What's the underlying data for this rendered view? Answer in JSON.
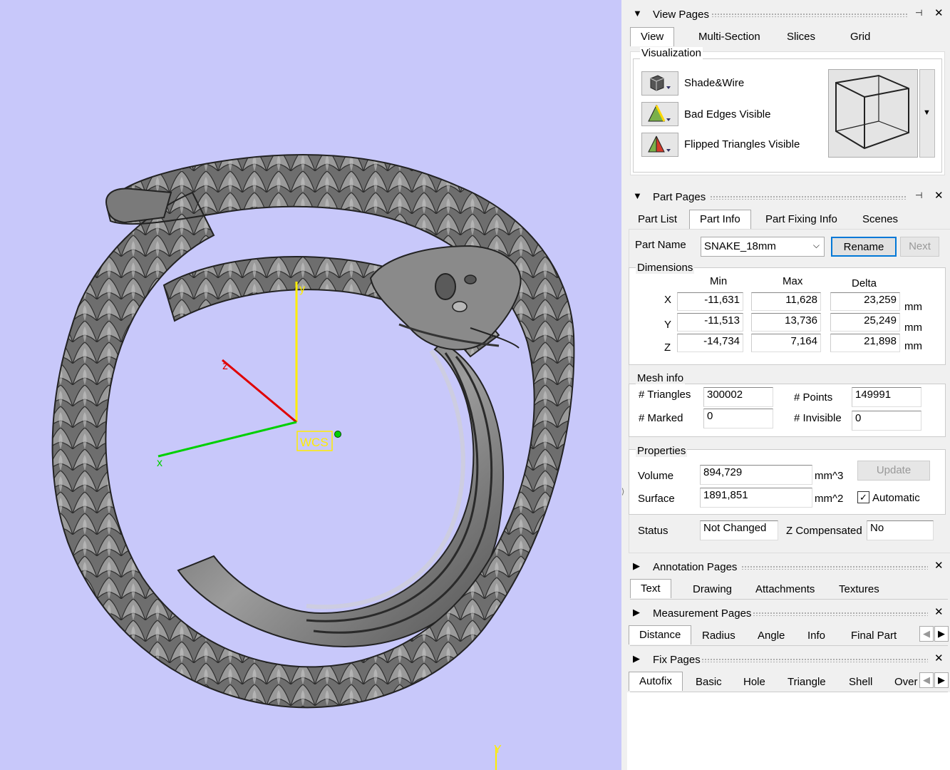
{
  "viewport": {
    "background": "#c8c8fa",
    "axis_labels": {
      "y": "y",
      "z": "z",
      "x": "x",
      "wcs": "WCS",
      "bottom_y": "Y"
    },
    "axis_colors": {
      "x": "#00d000",
      "y": "#ffee00",
      "z": "#e00000"
    },
    "model_color": "#6f6f6f"
  },
  "view_pages": {
    "title": "View Pages",
    "tabs": [
      "View",
      "Multi-Section",
      "Slices",
      "Grid"
    ],
    "active_tab": "View",
    "visualization": {
      "label": "Visualization",
      "items": [
        {
          "icon": "shade-wire-icon",
          "label": "Shade&Wire"
        },
        {
          "icon": "bad-edges-icon",
          "label": "Bad Edges Visible"
        },
        {
          "icon": "flipped-triangles-icon",
          "label": "Flipped Triangles Visible"
        }
      ],
      "preview_icon": "wireframe-cube-icon"
    }
  },
  "part_pages": {
    "title": "Part Pages",
    "tabs": [
      "Part List",
      "Part Info",
      "Part Fixing Info",
      "Scenes"
    ],
    "active_tab": "Part Info",
    "part_name_label": "Part Name",
    "part_name": "SNAKE_18mm",
    "rename_label": "Rename",
    "next_label": "Next",
    "dimensions": {
      "label": "Dimensions",
      "headers": [
        "Min",
        "Max",
        "Delta"
      ],
      "rows": [
        {
          "axis": "X",
          "min": "-11,631",
          "max": "11,628",
          "delta": "23,259",
          "unit": "mm"
        },
        {
          "axis": "Y",
          "min": "-11,513",
          "max": "13,736",
          "delta": "25,249",
          "unit": "mm"
        },
        {
          "axis": "Z",
          "min": "-14,734",
          "max": "7,164",
          "delta": "21,898",
          "unit": "mm"
        }
      ]
    },
    "mesh_info": {
      "label": "Mesh info",
      "triangles_label": "# Triangles",
      "triangles": "300002",
      "points_label": "# Points",
      "points": "149991",
      "marked_label": "# Marked",
      "marked": "0",
      "invisible_label": "# Invisible",
      "invisible": "0"
    },
    "properties": {
      "label": "Properties",
      "volume_label": "Volume",
      "volume": "894,729",
      "volume_unit": "mm^3",
      "surface_label": "Surface",
      "surface": "1891,851",
      "surface_unit": "mm^2",
      "update_label": "Update",
      "automatic_label": "Automatic",
      "automatic_checked": true
    },
    "status_label": "Status",
    "status": "Not Changed",
    "zcomp_label": "Z Compensated",
    "zcomp": "No"
  },
  "annotation_pages": {
    "title": "Annotation Pages",
    "tabs": [
      "Text",
      "Drawing",
      "Attachments",
      "Textures"
    ],
    "active_tab": "Text"
  },
  "measurement_pages": {
    "title": "Measurement Pages",
    "tabs": [
      "Distance",
      "Radius",
      "Angle",
      "Info",
      "Final Part"
    ],
    "active_tab": "Distance"
  },
  "fix_pages": {
    "title": "Fix Pages",
    "tabs": [
      "Autofix",
      "Basic",
      "Hole",
      "Triangle",
      "Shell",
      "Over"
    ],
    "active_tab": "Autofix"
  }
}
